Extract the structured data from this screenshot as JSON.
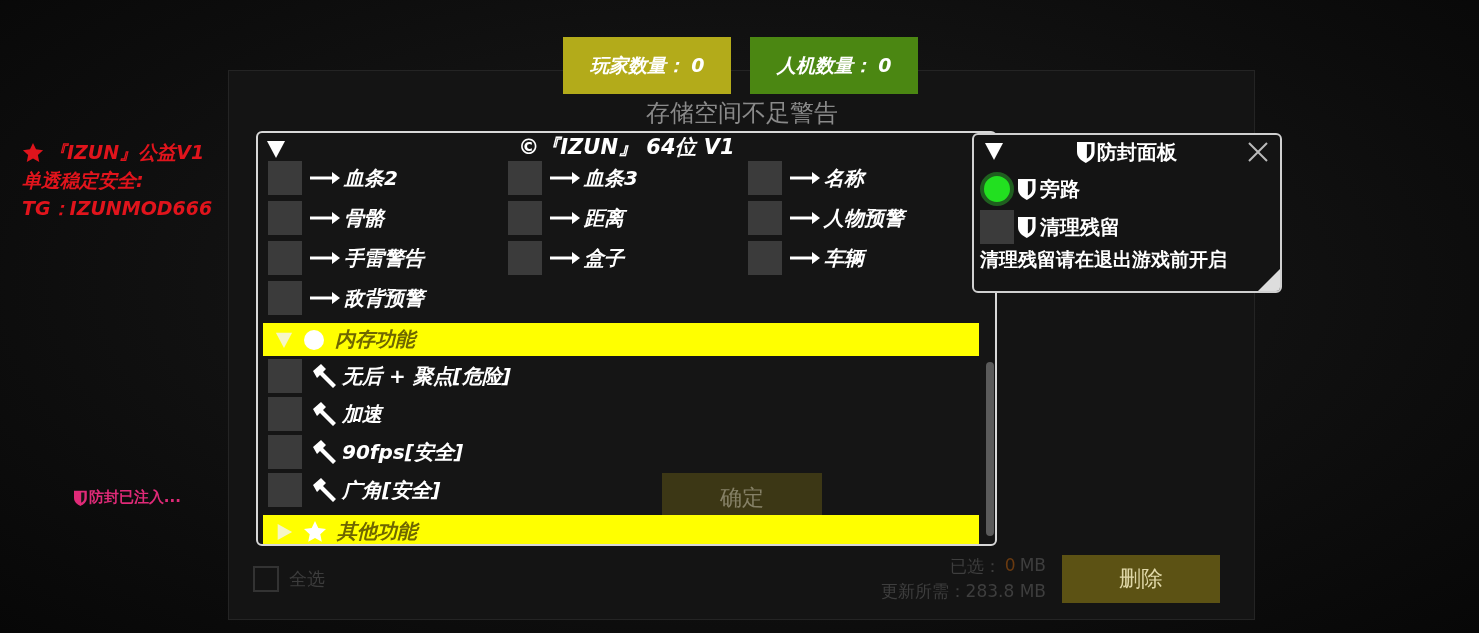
{
  "counters": [
    {
      "label": "玩家数量： 0",
      "color": "#b3ab1a"
    },
    {
      "label": "人机数量： 0",
      "color": "#4b8712"
    }
  ],
  "notice": {
    "lines": [
      "『IZUN』公益V1",
      "单透稳定安全:",
      "TG：IZUNMOD666"
    ]
  },
  "status": "防封已注入...",
  "dialog": {
    "title": "存储空间不足警告",
    "confirm": "确定",
    "select_all": {
      "label": "全选",
      "checked": false
    },
    "selected_label": "已选：",
    "selected_value": "0",
    "selected_unit": "MB",
    "required": "更新所需：283.8 MB",
    "delete": "删除"
  },
  "menu": {
    "title": "©『IZUN』 64位 V1",
    "expanded": true,
    "esp_items": [
      {
        "label": "血条2",
        "checked": false
      },
      {
        "label": "血条3",
        "checked": false
      },
      {
        "label": "名称",
        "checked": false
      },
      {
        "label": "骨骼",
        "checked": false
      },
      {
        "label": "距离",
        "checked": false
      },
      {
        "label": "人物预警",
        "checked": false
      },
      {
        "label": "手雷警告",
        "checked": false
      },
      {
        "label": "盒子",
        "checked": false
      },
      {
        "label": "车辆",
        "checked": false
      },
      {
        "label": "敌背预警",
        "checked": false
      }
    ],
    "sections": [
      {
        "kind": "memory",
        "title": "内存功能",
        "expanded": true,
        "items": [
          {
            "label": "无后 + 聚点[危险]",
            "checked": false
          },
          {
            "label": "加速",
            "checked": false
          },
          {
            "label": "90fps[安全]",
            "checked": false
          },
          {
            "label": "广角[安全]",
            "checked": false
          }
        ]
      },
      {
        "kind": "other",
        "title": "其他功能",
        "expanded": false
      }
    ]
  },
  "panel": {
    "title": "防封面板",
    "expanded": true,
    "items": [
      {
        "label": "旁路",
        "on": true
      },
      {
        "label": "清理残留",
        "on": false
      }
    ],
    "note": "清理残留请在退出游戏前开启"
  }
}
